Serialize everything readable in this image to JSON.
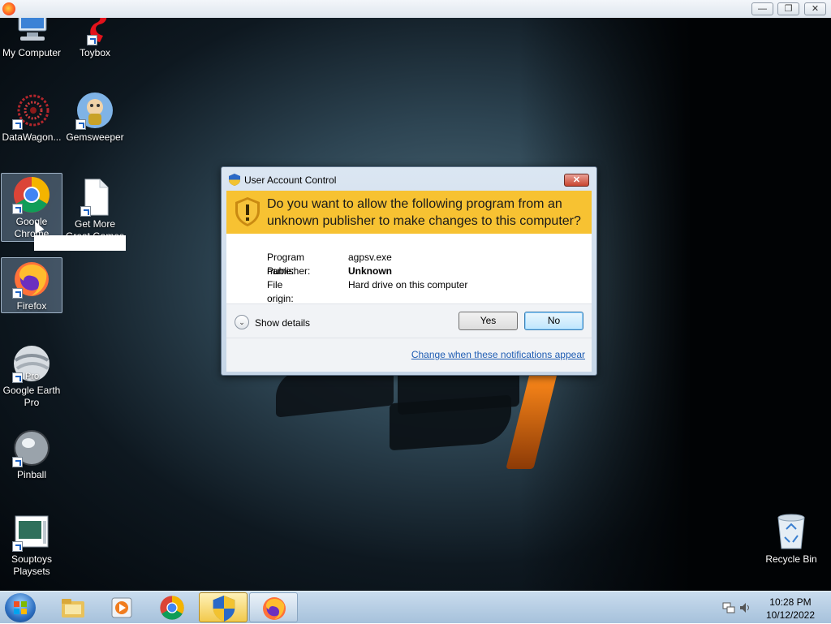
{
  "window": {
    "minimize_glyph": "—",
    "restore_glyph": "❐",
    "close_glyph": "✕"
  },
  "desktop": {
    "icons": [
      {
        "label": "My Computer",
        "icon": "computer-icon"
      },
      {
        "label": "Toybox",
        "icon": "toybox-icon"
      },
      {
        "label": "DataWagon...",
        "icon": "datawagon-icon"
      },
      {
        "label": "Gemsweeper",
        "icon": "gemsweeper-icon"
      },
      {
        "label": "Google Chrome",
        "icon": "chrome-icon"
      },
      {
        "label": "Get More Great Games",
        "icon": "document-icon"
      },
      {
        "label": "Firefox",
        "icon": "firefox-icon"
      },
      {
        "label": "Google Earth Pro",
        "icon": "google-earth-icon",
        "badge": "Pro"
      },
      {
        "label": "Pinball",
        "icon": "pinball-icon"
      },
      {
        "label": "Souptoys Playsets",
        "icon": "souptoys-icon"
      }
    ],
    "recycle_bin": "Recycle Bin"
  },
  "dialog": {
    "title": "User Account Control",
    "close": "✕",
    "question": "Do you want to allow the following program from an unknown publisher to make changes to this computer?",
    "fields": [
      {
        "key": "Program name:",
        "value": "agpsv.exe"
      },
      {
        "key": "Publisher:",
        "value": "Unknown"
      },
      {
        "key": "File origin:",
        "value": "Hard drive on this computer"
      }
    ],
    "show_details": "Show details",
    "yes": "Yes",
    "no": "No",
    "notifications_link": "Change when these notifications appear"
  },
  "taskbar": {
    "time": "10:28 PM",
    "date": "10/12/2022",
    "items": [
      "explorer-icon",
      "media-player-icon",
      "chrome-icon",
      "uac-shield-icon",
      "firefox-icon"
    ]
  },
  "colors": {
    "warning_band": "#f7c232",
    "link": "#1e5cb3",
    "taskbar": "#b6cde3"
  }
}
